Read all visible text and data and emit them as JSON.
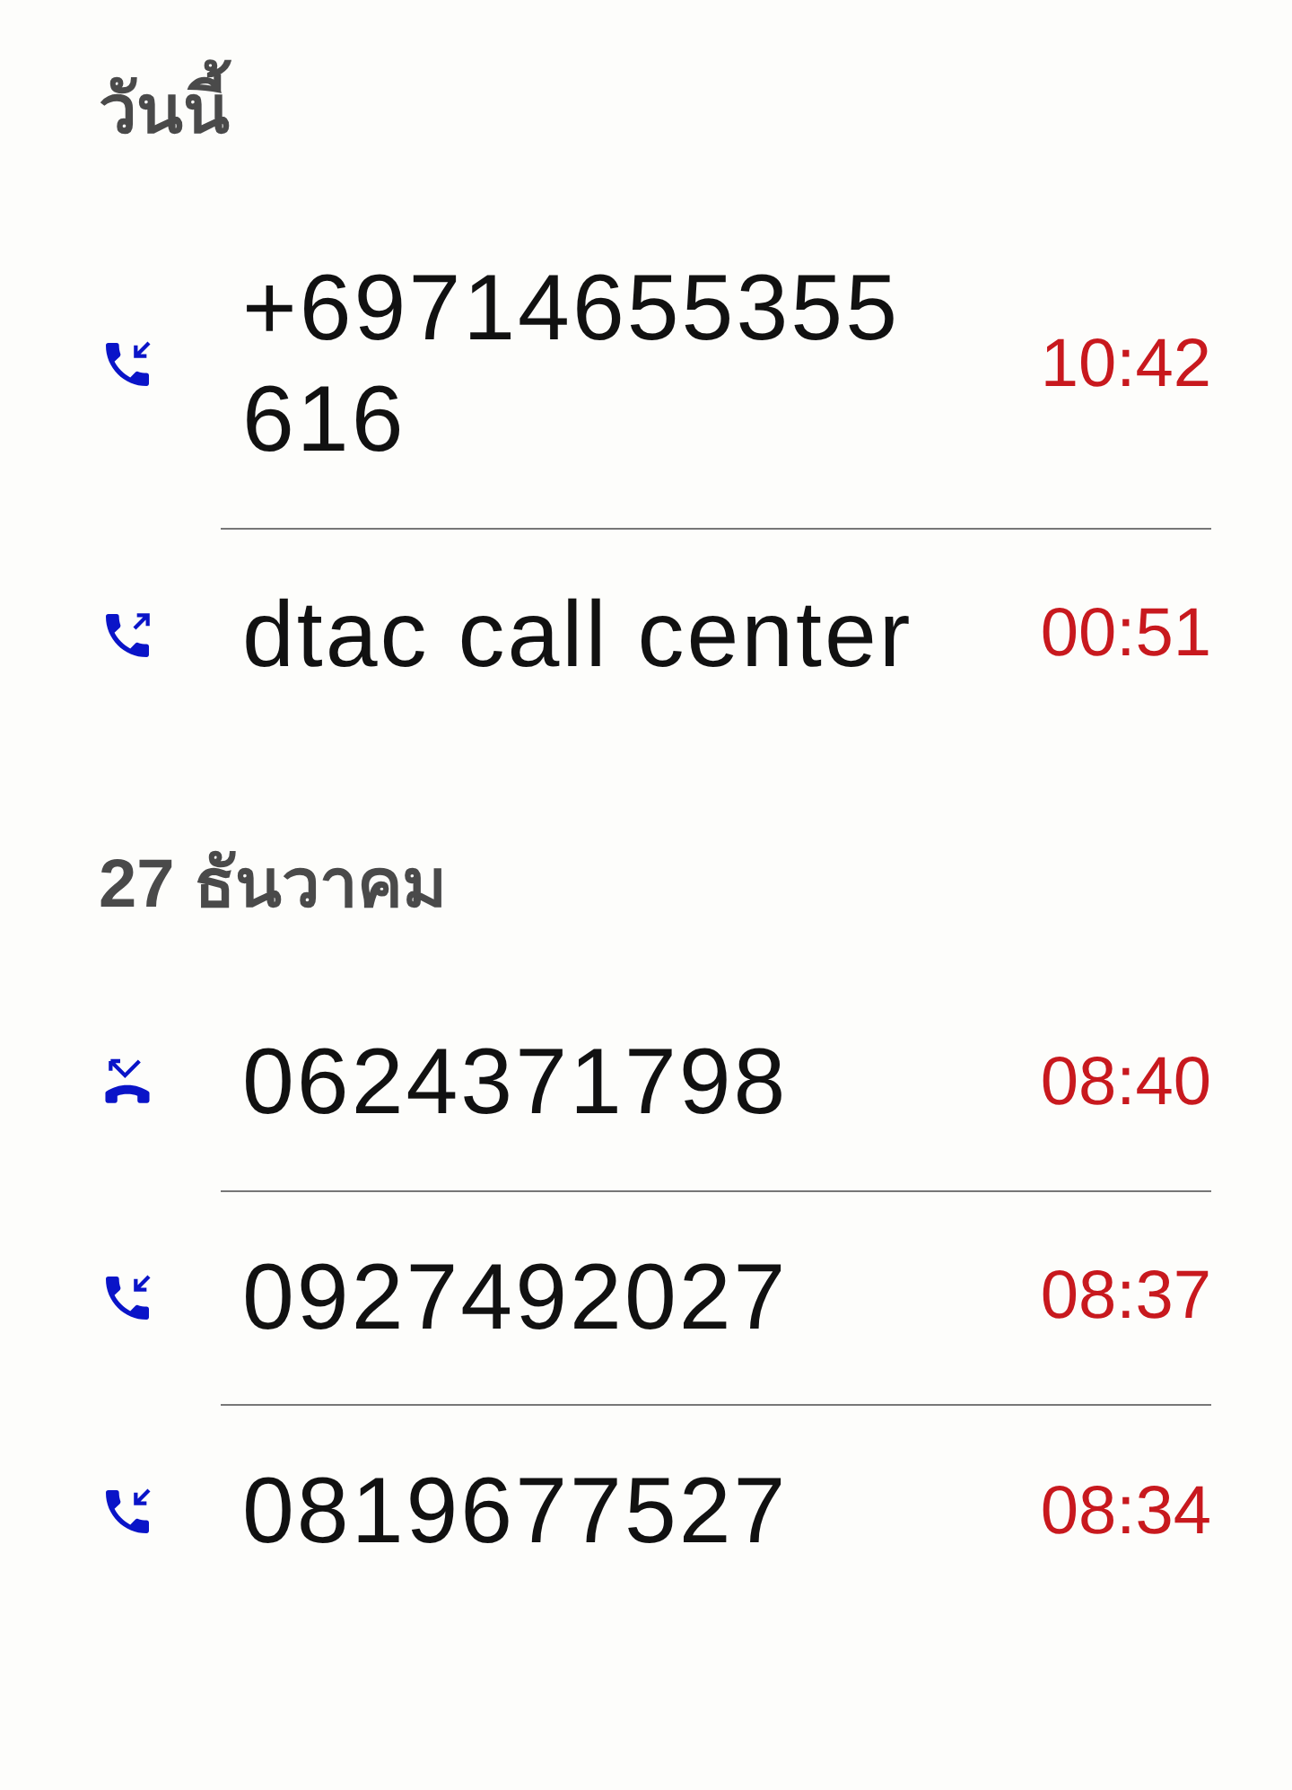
{
  "sections": [
    {
      "title": "วันนี้",
      "calls": [
        {
          "kind": "incoming",
          "name": "+69714655355616",
          "time": "10:42"
        },
        {
          "kind": "outgoing",
          "name": "dtac call center",
          "time": "00:51"
        }
      ]
    },
    {
      "title": "27 ธันวาคม",
      "calls": [
        {
          "kind": "rejected",
          "name": "0624371798",
          "time": "08:40"
        },
        {
          "kind": "incoming",
          "name": "0927492027",
          "time": "08:37"
        },
        {
          "kind": "incoming",
          "name": "0819677527",
          "time": "08:34"
        }
      ]
    }
  ]
}
